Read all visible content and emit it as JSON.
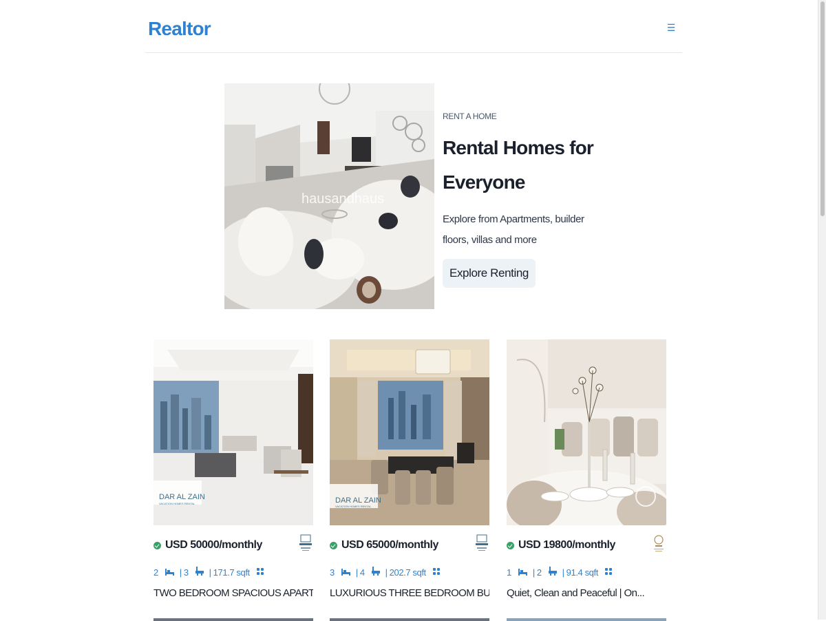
{
  "navbar": {
    "brand": "Realtor",
    "menu_icon": "hamburger-menu-icon",
    "brand_color": "#3182ce"
  },
  "hero": {
    "eyebrow": "RENT A HOME",
    "title_line1": "Rental Homes for",
    "title_line2": "Everyone",
    "description": "Explore from Apartments, builder floors, villas and more",
    "button_label": "Explore Renting",
    "image_watermark": "hausandhaus"
  },
  "listings": [
    {
      "price": "USD 50000/monthly",
      "rooms": "2",
      "baths": "3",
      "area": "171.7 sqft",
      "title": "TWO BEDROOM SPACIOUS APARTMENT...",
      "agency_watermark_line1": "DAR AL ZAIN",
      "agency_watermark_line2": "VACATION HOMES RENTAL"
    },
    {
      "price": "USD 65000/monthly",
      "rooms": "3",
      "baths": "4",
      "area": "202.7 sqft",
      "title": "LUXURIOUS THREE BEDROOM BURJ ...",
      "agency_watermark_line1": "DAR AL ZAIN",
      "agency_watermark_line2": "VACATION HOMES RENTAL"
    },
    {
      "price": "USD 19800/monthly",
      "rooms": "1",
      "baths": "2",
      "area": "91.4 sqft",
      "title": "Quiet, Clean and Peaceful | On...",
      "agency_watermark_line1": "",
      "agency_watermark_line2": ""
    }
  ],
  "colors": {
    "accent": "#3182ce",
    "verified": "#38a169",
    "button_bg": "#edf2f7"
  }
}
